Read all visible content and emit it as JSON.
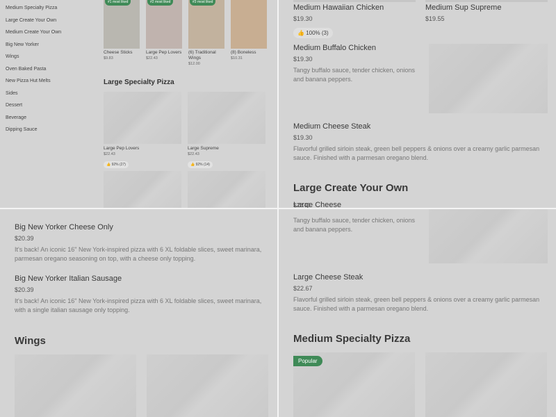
{
  "sidebar": {
    "items": [
      "Medium Specialty Pizza",
      "Large Create Your Own",
      "Medium Create Your Own",
      "Big New Yorker",
      "Wings",
      "Oven Baked Pasta",
      "New Pizza Hut Melts",
      "Sides",
      "Dessert",
      "Beverage",
      "Dipping Sauce"
    ]
  },
  "most_liked": [
    {
      "badge": "#1 most liked",
      "name": "Cheese Sticks",
      "price": "$9.83"
    },
    {
      "badge": "#2 most liked",
      "name": "Large Pep Lovers",
      "price": "$22.43"
    },
    {
      "badge": "#3 most liked",
      "name": "(6) Traditional Wings",
      "price": "$12.00"
    },
    {
      "badge": "",
      "name": "(8) Boneless",
      "price": "$10.31"
    }
  ],
  "q1_section": {
    "title": "Large Specialty Pizza",
    "cards": [
      {
        "name": "Large Pep Lovers",
        "price": "$22.43",
        "rating": "92% (27)"
      },
      {
        "name": "Large Supreme",
        "price": "$22.43",
        "rating": "92% (14)"
      }
    ]
  },
  "q2": {
    "top_left": {
      "name": "Medium Hawaiian Chicken",
      "price": "$19.30",
      "rating": "100% (3)"
    },
    "top_right": {
      "name": "Medium Sup Supreme",
      "price": "$19.55"
    },
    "buffalo": {
      "name": "Medium Buffalo Chicken",
      "price": "$19.30",
      "desc": "Tangy buffalo sauce, tender chicken, onions and banana peppers."
    },
    "steak": {
      "name": "Medium Cheese Steak",
      "price": "$19.30",
      "desc": "Flavorful grilled sirloin steak, green bell peppers & onions over a creamy garlic parmesan sauce. Finished with a parmesan oregano blend."
    },
    "section": "Large Create Your Own",
    "partial_name": "Large Cheese",
    "partial_price": "$22.43"
  },
  "q3": {
    "cheese_only": {
      "name": "Big New Yorker Cheese Only",
      "price": "$20.39",
      "desc": "It's back! An iconic 16\" New York-inspired pizza with 6 XL foldable slices, sweet marinara, parmesan oregano seasoning on top, with a cheese only topping."
    },
    "sausage": {
      "name": "Big New Yorker Italian Sausage",
      "price": "$20.39",
      "desc": "It's back! An iconic 16\" New York-inspired pizza with 6 XL foldable slices, sweet marinara, with a single italian sausage only topping."
    },
    "section": "Wings"
  },
  "q4": {
    "buffalo_desc": "Tangy buffalo sauce, tender chicken, onions and banana peppers.",
    "steak": {
      "name": "Large Cheese Steak",
      "price": "$22.67",
      "desc": "Flavorful grilled sirloin steak, green bell peppers & onions over a creamy garlic parmesan sauce. Finished with a parmesan oregano blend."
    },
    "section": "Medium Specialty Pizza",
    "popular": "Popular"
  }
}
